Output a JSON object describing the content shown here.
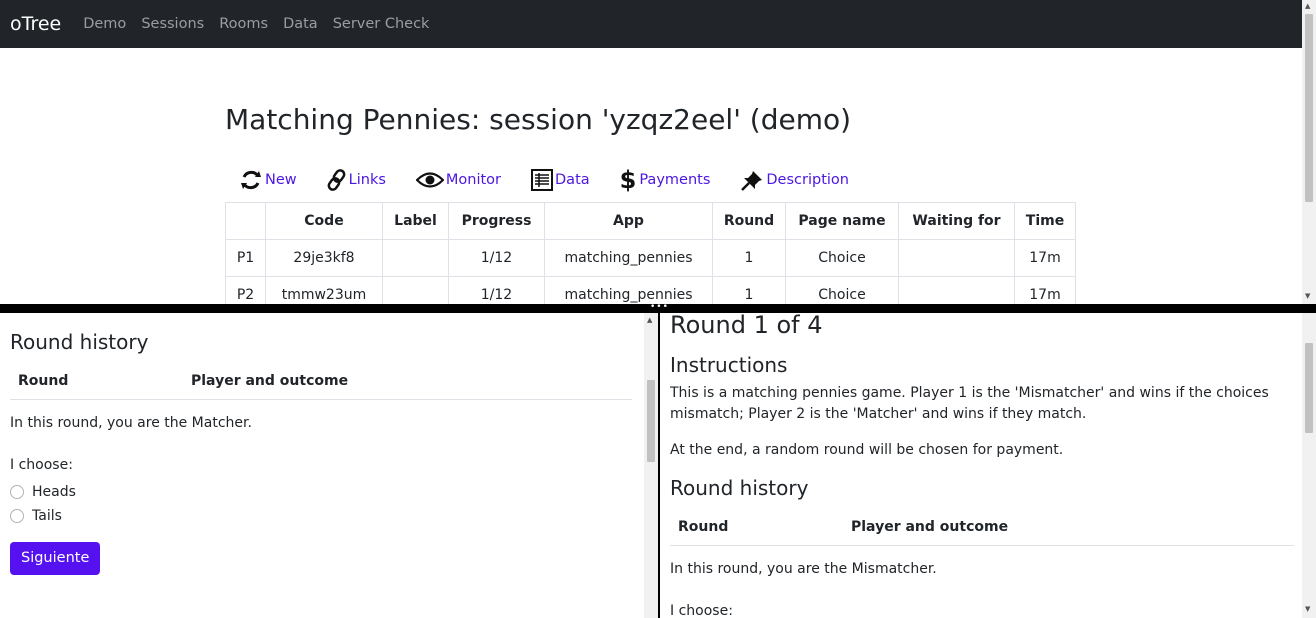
{
  "nav": {
    "brand": "oTree",
    "links": [
      "Demo",
      "Sessions",
      "Rooms",
      "Data",
      "Server Check"
    ]
  },
  "page": {
    "title": "Matching Pennies: session 'yzqz2eel' (demo)",
    "actions": [
      {
        "label": "New",
        "icon": "refresh-icon"
      },
      {
        "label": "Links",
        "icon": "link-icon"
      },
      {
        "label": "Monitor",
        "icon": "eye-icon"
      },
      {
        "label": "Data",
        "icon": "table-icon"
      },
      {
        "label": "Payments",
        "icon": "dollar-icon"
      },
      {
        "label": "Description",
        "icon": "pin-icon"
      }
    ],
    "table": {
      "headers": [
        "",
        "Code",
        "Label",
        "Progress",
        "App",
        "Round",
        "Page name",
        "Waiting for",
        "Time"
      ],
      "rows": [
        [
          "P1",
          "29je3kf8",
          "",
          "1/12",
          "matching_pennies",
          "1",
          "Choice",
          "",
          "17m"
        ],
        [
          "P2",
          "tmmw23um",
          "",
          "1/12",
          "matching_pennies",
          "1",
          "Choice",
          "",
          "17m"
        ]
      ]
    }
  },
  "left_pane": {
    "history_title": "Round history",
    "col_round": "Round",
    "col_outcome": "Player and outcome",
    "role_text": "In this round, you are the Matcher.",
    "choose_label": "I choose:",
    "options": [
      "Heads",
      "Tails"
    ],
    "next_button": "Siguiente"
  },
  "right_pane": {
    "round_title": "Round 1 of 4",
    "instructions_title": "Instructions",
    "instructions_p1": "This is a matching pennies game. Player 1 is the 'Mismatcher' and wins if the choices mismatch; Player 2 is the 'Matcher' and wins if they match.",
    "instructions_p2": "At the end, a random round will be chosen for payment.",
    "history_title": "Round history",
    "col_round": "Round",
    "col_outcome": "Player and outcome",
    "role_text": "In this round, you are the Mismatcher.",
    "choose_label": "I choose:"
  },
  "colors": {
    "navbar": "#212529",
    "link": "#4d18e0",
    "button": "#5511f0"
  }
}
